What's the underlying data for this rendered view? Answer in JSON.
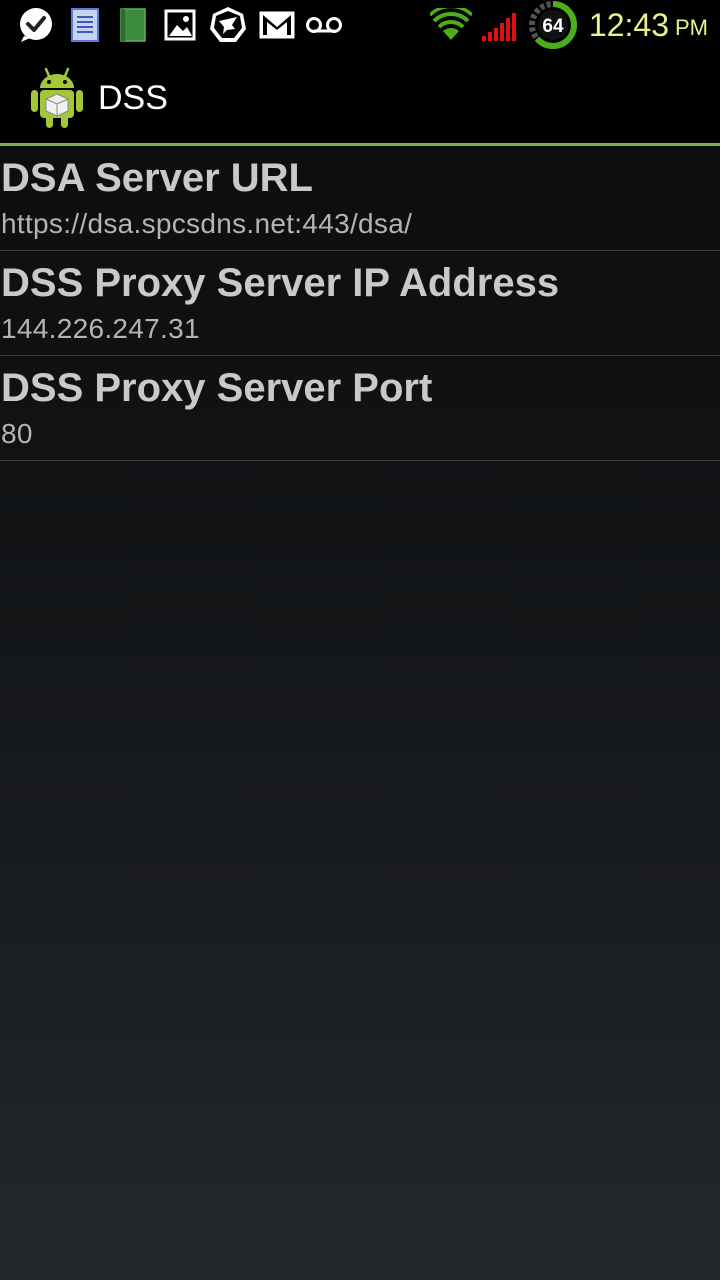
{
  "status_bar": {
    "icons": [
      "messenger-check-icon",
      "notes-icon",
      "green-book-icon",
      "gallery-icon",
      "shield-bird-icon",
      "gmail-icon",
      "voicemail-icon",
      "wifi-icon",
      "signal-icon",
      "battery-icon"
    ],
    "battery_level": "64",
    "time": "12:43",
    "ampm": "PM",
    "colors": {
      "wifi": "#4caf1a",
      "signal": "#e01010",
      "clock": "#e9f08c",
      "battery_ring": "#4caf1a"
    }
  },
  "action_bar": {
    "icon": "android-app-icon",
    "title": "DSS",
    "accent_color": "#7cb342"
  },
  "preferences": [
    {
      "title": "DSA Server URL",
      "summary": "https://dsa.spcsdns.net:443/dsa/"
    },
    {
      "title": "DSS Proxy Server IP Address",
      "summary": "144.226.247.31"
    },
    {
      "title": "DSS Proxy Server Port",
      "summary": "80"
    }
  ]
}
